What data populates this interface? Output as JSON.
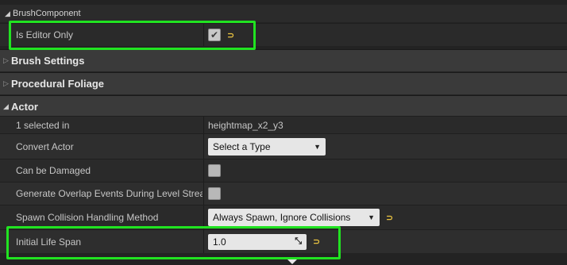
{
  "brush_component": {
    "header": "BrushComponent",
    "is_editor_only": {
      "label": "Is Editor Only",
      "checked": true
    }
  },
  "categories": {
    "brush_settings": "Brush Settings",
    "procedural_foliage": "Procedural Foliage",
    "actor": "Actor"
  },
  "actor": {
    "selected": {
      "label": "1 selected in",
      "value": "heightmap_x2_y3"
    },
    "convert_actor": {
      "label": "Convert Actor",
      "value": "Select a Type"
    },
    "can_be_damaged": {
      "label": "Can be Damaged",
      "checked": false
    },
    "overlap_events": {
      "label": "Generate Overlap Events During Level Streaming",
      "checked": false
    },
    "spawn_collision": {
      "label": "Spawn Collision Handling Method",
      "value": "Always Spawn, Ignore Collisions"
    },
    "initial_life_span": {
      "label": "Initial Life Span",
      "value": "1.0"
    }
  },
  "colors": {
    "highlight": "#21e321",
    "reset_arrow": "#e9c341",
    "category_bg": "#3a3a3a"
  },
  "icons": {
    "expanded": "triangle-down-icon",
    "collapsed": "triangle-right-icon",
    "reset": "reset-to-default-icon",
    "drag": "drag-resize-icon"
  }
}
